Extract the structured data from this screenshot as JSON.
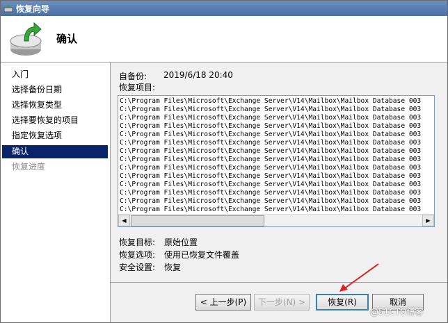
{
  "window": {
    "title": "恢复向导"
  },
  "header": {
    "title": "确认"
  },
  "sidebar": {
    "items": [
      {
        "label": "入门",
        "state": "normal"
      },
      {
        "label": "选择备份日期",
        "state": "normal"
      },
      {
        "label": "选择恢复类型",
        "state": "normal"
      },
      {
        "label": "选择要恢复的项目",
        "state": "normal"
      },
      {
        "label": "指定恢复选项",
        "state": "normal"
      },
      {
        "label": "确认",
        "state": "active"
      },
      {
        "label": "恢复进度",
        "state": "disabled"
      }
    ]
  },
  "content": {
    "backup_from_label": "自备份:",
    "backup_from_value": "2019/6/18 20:40",
    "items_label": "恢复项目:",
    "items": [
      "C:\\Program Files\\Microsoft\\Exchange Server\\V14\\Mailbox\\Mailbox Database 003",
      "C:\\Program Files\\Microsoft\\Exchange Server\\V14\\Mailbox\\Mailbox Database 003",
      "C:\\Program Files\\Microsoft\\Exchange Server\\V14\\Mailbox\\Mailbox Database 003",
      "C:\\Program Files\\Microsoft\\Exchange Server\\V14\\Mailbox\\Mailbox Database 003",
      "C:\\Program Files\\Microsoft\\Exchange Server\\V14\\Mailbox\\Mailbox Database 003",
      "C:\\Program Files\\Microsoft\\Exchange Server\\V14\\Mailbox\\Mailbox Database 003",
      "C:\\Program Files\\Microsoft\\Exchange Server\\V14\\Mailbox\\Mailbox Database 003",
      "C:\\Program Files\\Microsoft\\Exchange Server\\V14\\Mailbox\\Mailbox Database 003",
      "C:\\Program Files\\Microsoft\\Exchange Server\\V14\\Mailbox\\Mailbox Database 003",
      "C:\\Program Files\\Microsoft\\Exchange Server\\V14\\Mailbox\\Mailbox Database 003",
      "C:\\Program Files\\Microsoft\\Exchange Server\\V14\\Mailbox\\Mailbox Database 003",
      "C:\\Program Files\\Microsoft\\Exchange Server\\V14\\Mailbox\\Mailbox Database 003",
      "C:\\Program Files\\Microsoft\\Exchange Server\\V14\\Mailbox\\Mailbox Database 003",
      "C:\\Program Files\\Microsoft\\Exchange Server\\V14\\Mailbox\\Mailbox Database 003"
    ],
    "summary": {
      "target_label": "恢复目标:",
      "target_value": "原始位置",
      "option_label": "恢复选项:",
      "option_value": "使用已恢复文件覆盖",
      "security_label": "安全设置:",
      "security_value": "恢复"
    }
  },
  "buttons": {
    "back": "< 上一步(P)",
    "next": "下一步(N) >",
    "recover": "恢复(R)",
    "cancel": "取消"
  },
  "watermark": "@51CTO博客",
  "colors": {
    "selection": "#0a246a",
    "arrow": "#e02020",
    "titlebar": "#4a6fa5"
  }
}
